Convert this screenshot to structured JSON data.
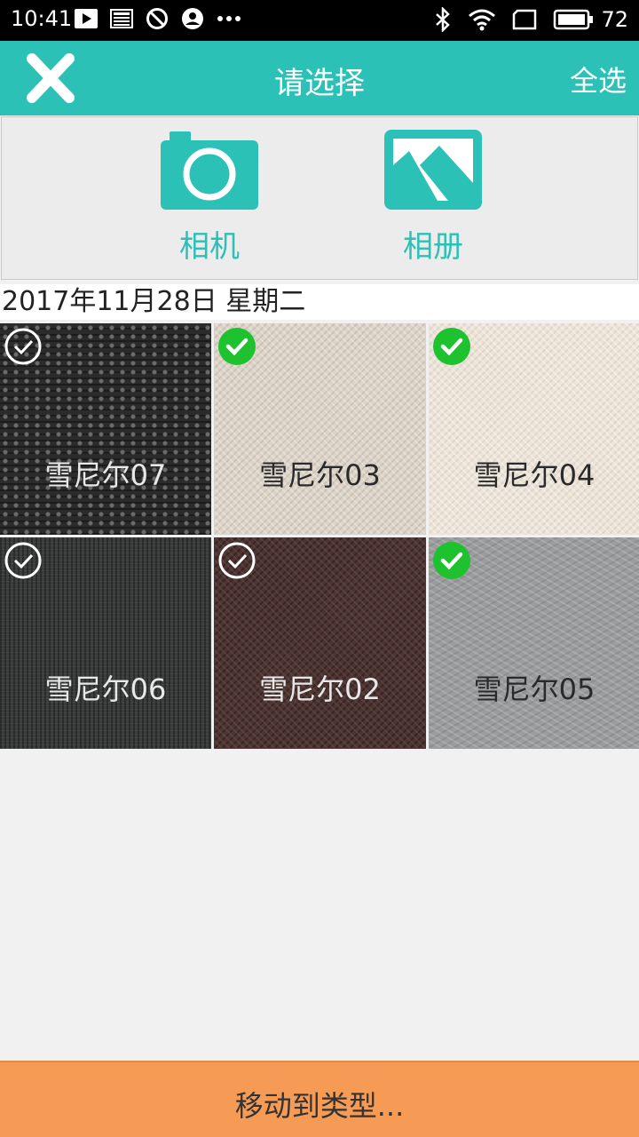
{
  "status_bar": {
    "time": "10:41",
    "battery": "72",
    "icons": [
      "play-icon",
      "news-icon",
      "block-icon",
      "account-icon",
      "more-dots-icon",
      "bluetooth-icon",
      "wifi-icon",
      "screen-icon",
      "battery-icon"
    ]
  },
  "header": {
    "title": "请选择",
    "select_all": "全选",
    "close_icon": "close-icon",
    "color": "#2bc1b6"
  },
  "source": {
    "camera_label": "相机",
    "album_label": "相册",
    "accent": "#2bc1b6"
  },
  "date_header": "2017年11月28日 星期二",
  "grid": {
    "items": [
      {
        "label": "雪尼尔07",
        "selected": false
      },
      {
        "label": "雪尼尔03",
        "selected": true
      },
      {
        "label": "雪尼尔04",
        "selected": true
      },
      {
        "label": "雪尼尔06",
        "selected": false
      },
      {
        "label": "雪尼尔02",
        "selected": false
      },
      {
        "label": "雪尼尔05",
        "selected": true
      }
    ],
    "selected_color": "#1ec22f"
  },
  "bottom_bar": {
    "label": "移动到类型...",
    "color": "#f59b55"
  }
}
